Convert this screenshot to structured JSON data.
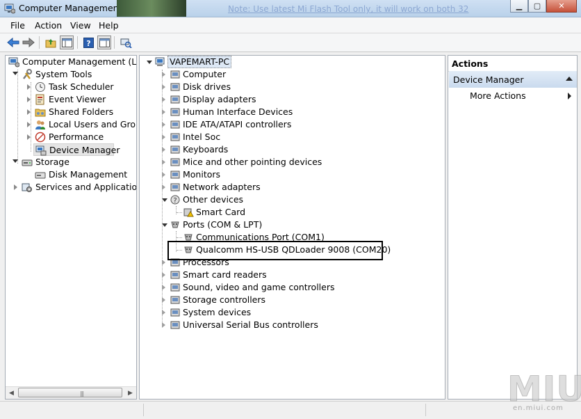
{
  "window": {
    "title": "Computer Management",
    "ghost_text": "Note: Use latest Mi Flash Tool only, it will work on both 32"
  },
  "menu": [
    "File",
    "Action",
    "View",
    "Help"
  ],
  "tree": {
    "root": "Computer Management (Local",
    "system_tools": "System Tools",
    "system_items": [
      "Task Scheduler",
      "Event Viewer",
      "Shared Folders",
      "Local Users and Groups",
      "Performance",
      "Device Manager"
    ],
    "storage": "Storage",
    "storage_items": [
      "Disk Management"
    ],
    "services": "Services and Applications"
  },
  "devices": {
    "root": "VAPEMART-PC",
    "items": [
      "Computer",
      "Disk drives",
      "Display adapters",
      "Human Interface Devices",
      "IDE ATA/ATAPI controllers",
      "Intel Soc",
      "Keyboards",
      "Mice and other pointing devices",
      "Monitors",
      "Network adapters"
    ],
    "other_devices": "Other devices",
    "other_children": [
      "Smart Card"
    ],
    "ports": "Ports (COM & LPT)",
    "ports_children": [
      "Communications Port (COM1)",
      "Qualcomm HS-USB QDLoader 9008 (COM20)"
    ],
    "after": [
      "Processors",
      "Smart card readers",
      "Sound, video and game controllers",
      "Storage controllers",
      "System devices",
      "Universal Serial Bus controllers"
    ]
  },
  "actions": {
    "header": "Actions",
    "section": "Device Manager",
    "more": "More Actions"
  },
  "watermark": {
    "big": "MIUI",
    "small": "en.miui.com"
  }
}
